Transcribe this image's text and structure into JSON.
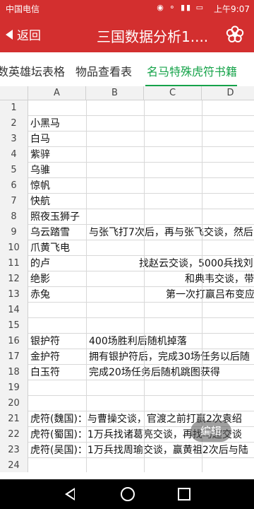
{
  "status_bar": {
    "carrier": "中国电信",
    "icons": "◉ ⚬ ▮▮ ▭",
    "time": "上午9:07"
  },
  "app_bar": {
    "back_label": "返回",
    "title": "三国数据分析1...."
  },
  "tabs": [
    {
      "label": "数英雄坛表格"
    },
    {
      "label": "物品查看表"
    },
    {
      "label": "名马特殊虎符书籍",
      "active": true
    }
  ],
  "columns": [
    "A",
    "B",
    "C",
    "D"
  ],
  "rows": [
    {
      "num": "1",
      "a": "",
      "b": ""
    },
    {
      "num": "2",
      "a": "小黑马",
      "b": ""
    },
    {
      "num": "3",
      "a": "白马",
      "b": ""
    },
    {
      "num": "4",
      "a": "紫骍",
      "b": ""
    },
    {
      "num": "5",
      "a": "乌骓",
      "b": ""
    },
    {
      "num": "6",
      "a": "惊帆",
      "b": ""
    },
    {
      "num": "7",
      "a": "快航",
      "b": ""
    },
    {
      "num": "8",
      "a": "照夜玉狮子",
      "b": ""
    },
    {
      "num": "9",
      "a": "乌云踏雪",
      "b": "与张飞打7次后，再与张飞交谈，然后"
    },
    {
      "num": "10",
      "a": "爪黄飞电",
      "b": ""
    },
    {
      "num": "11",
      "a": "的卢",
      "b": "找赵云交谈，5000兵找刘",
      "b_align": "offset1"
    },
    {
      "num": "12",
      "a": "绝影",
      "b": "和典韦交谈，带",
      "b_align": "offset2"
    },
    {
      "num": "13",
      "a": "赤兔",
      "b": "第一次打赢吕布变应",
      "b_align": "offset3"
    },
    {
      "num": "14",
      "a": "",
      "b": ""
    },
    {
      "num": "15",
      "a": "",
      "b": ""
    },
    {
      "num": "16",
      "a": "银护符",
      "b": "400场胜利后随机掉落"
    },
    {
      "num": "17",
      "a": "金护符",
      "b": "拥有银护符后，完成30场任务以后随"
    },
    {
      "num": "18",
      "a": "白玉符",
      "b": "完成20场任务后随机跳图获得"
    },
    {
      "num": "19",
      "a": "",
      "b": ""
    },
    {
      "num": "20",
      "a": "",
      "b": ""
    },
    {
      "num": "21",
      "a": "虎符(魏国)：与曹操交谈，官渡之前打赢2次袁绍",
      "b": ""
    },
    {
      "num": "22",
      "a": "虎符(蜀国)：1万兵找诸葛亮交谈，再找马超交谈",
      "b": ""
    },
    {
      "num": "23",
      "a": "虎符(吴国)：1万兵找周瑜交谈，赢黄祖2次后与陆",
      "b": ""
    },
    {
      "num": "24",
      "a": "",
      "b": ""
    }
  ],
  "fab_label": "编辑",
  "colors": {
    "primary": "#d32f2f",
    "tab_active": "#16a34a"
  }
}
